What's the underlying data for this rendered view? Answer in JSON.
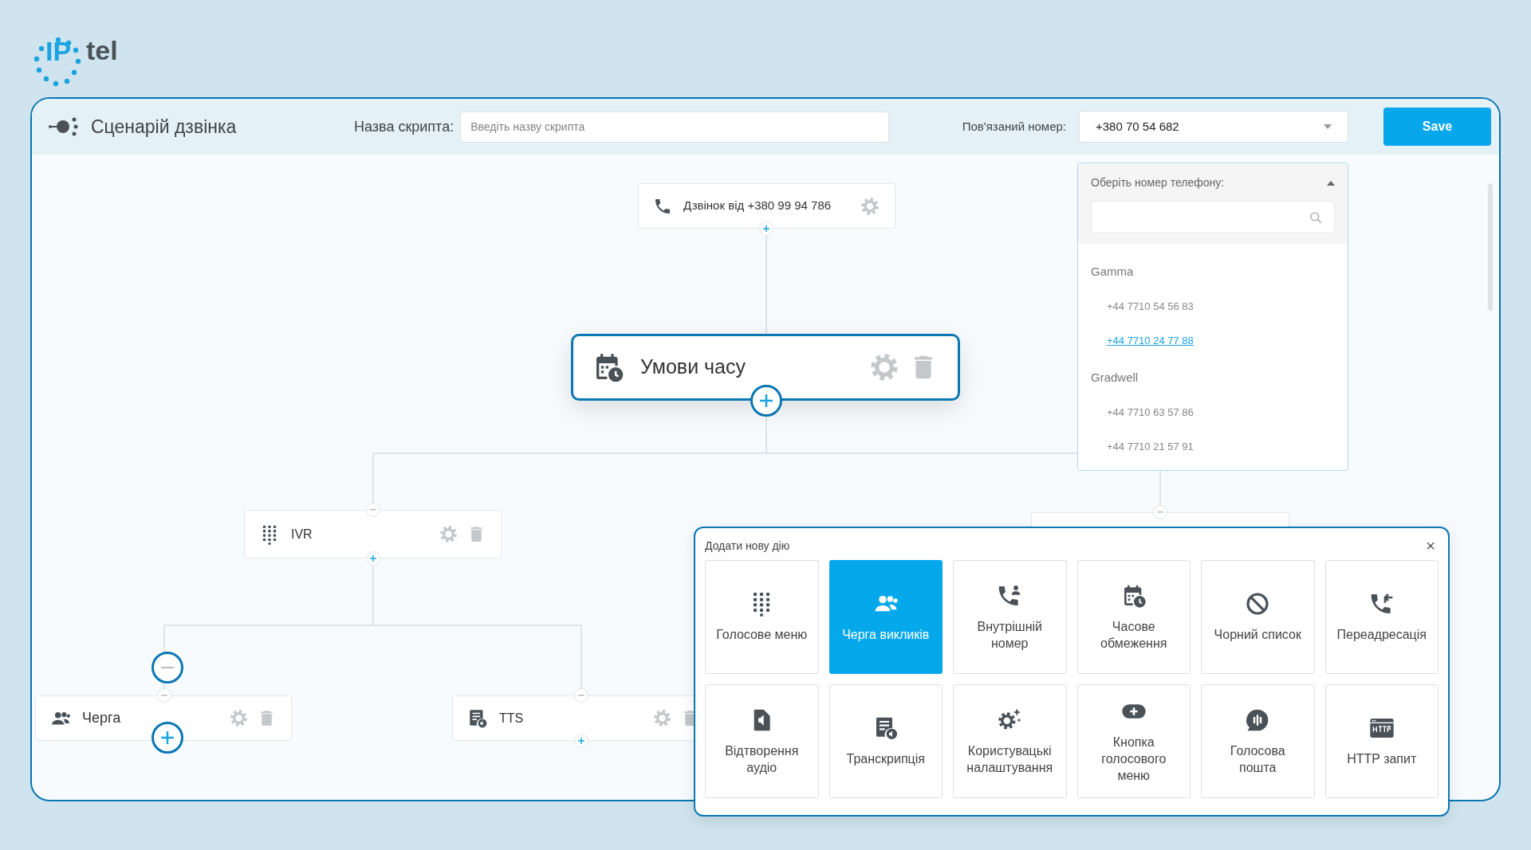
{
  "logo": {
    "part_a": "IP",
    "part_b": "tel"
  },
  "header": {
    "title": "Сценарій дзвінка",
    "script_label": "Назва скрипта:",
    "script_placeholder": "Введіть назву скрипта",
    "number_label": "Пов'язаний номер:",
    "number_value": "+380 70 54 682",
    "save": "Save"
  },
  "number_dropdown": {
    "expanded": true,
    "title": "Оберіть номер телефону:",
    "groups": [
      {
        "name": "Gamma",
        "numbers": [
          {
            "text": "+44 7710 54 56 83",
            "selected": false
          },
          {
            "text": "+44 7710 24 77 88",
            "selected": true
          }
        ]
      },
      {
        "name": "Gradwell",
        "numbers": [
          {
            "text": "+44 7710 63 57 86",
            "selected": false
          },
          {
            "text": "+44 7710 21 57 91",
            "selected": false
          }
        ]
      }
    ]
  },
  "nodes": [
    {
      "kind": "trigger",
      "label": "Дзвінок від +380 99 94 786",
      "selected": false
    },
    {
      "kind": "time",
      "label": "Умови часу",
      "selected": true
    },
    {
      "kind": "ivr",
      "label": "IVR",
      "selected": false
    },
    {
      "kind": "queue",
      "label": "Черга",
      "selected": false
    },
    {
      "kind": "tts",
      "label": "TTS",
      "selected": false
    },
    {
      "kind": "hidden",
      "selected": false
    }
  ],
  "add_action_panel": {
    "title": "Додати нову дію",
    "close": "×",
    "actions": [
      {
        "kind": "dialpad",
        "label": "Голосове меню",
        "selected": false
      },
      {
        "kind": "queue",
        "label": "Черга викликів",
        "selected": true
      },
      {
        "kind": "extension",
        "label": "Внутрішній номер",
        "selected": false
      },
      {
        "kind": "time",
        "label": "Часове обмеження",
        "selected": false
      },
      {
        "kind": "block",
        "label": "Чорний список",
        "selected": false
      },
      {
        "kind": "forward",
        "label": "Переадресація",
        "selected": false
      },
      {
        "kind": "audio",
        "label": "Відтворення аудіо",
        "selected": false
      },
      {
        "kind": "transcript",
        "label": "Транскрипція",
        "selected": false
      },
      {
        "kind": "custom",
        "label": "Користувацькі налаштування",
        "selected": false
      },
      {
        "kind": "button",
        "label": "Кнопка голосового меню",
        "selected": false
      },
      {
        "kind": "voicemail",
        "label": "Голосова пошта",
        "selected": false
      },
      {
        "kind": "http",
        "label": "HTTP запит",
        "selected": false
      }
    ]
  }
}
